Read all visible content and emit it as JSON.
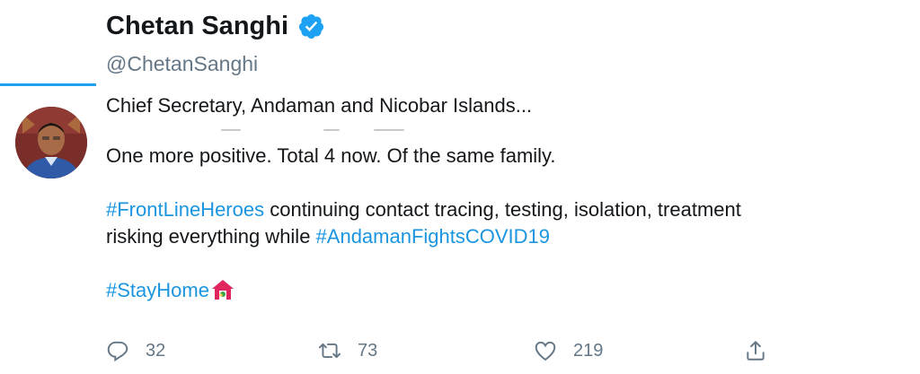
{
  "user": {
    "display_name": "Chetan Sanghi",
    "handle": "@ChetanSanghi"
  },
  "tweet": {
    "bio": "Chief Secretary, Andaman and Nicobar Islands...",
    "line1": "One more positive. Total 4 now. Of the same family.",
    "hashtag_frontline": "#FrontLineHeroes",
    "line2_rest": " continuing contact tracing, testing, isolation, treatment",
    "line3_prefix": "risking everything while ",
    "hashtag_andaman": "#AndamanFightsCOVID19",
    "hashtag_stayhome": "#StayHome"
  },
  "actions": {
    "reply_count": "32",
    "retweet_count": "73",
    "like_count": "219"
  },
  "colors": {
    "accent": "#1da1f2",
    "hashtag": "#1b95e0",
    "muted": "#657786",
    "house": "#e0245e"
  },
  "icons": [
    "verified-badge-icon",
    "reply-icon",
    "retweet-icon",
    "like-icon",
    "share-icon",
    "house-with-garden-emoji"
  ]
}
